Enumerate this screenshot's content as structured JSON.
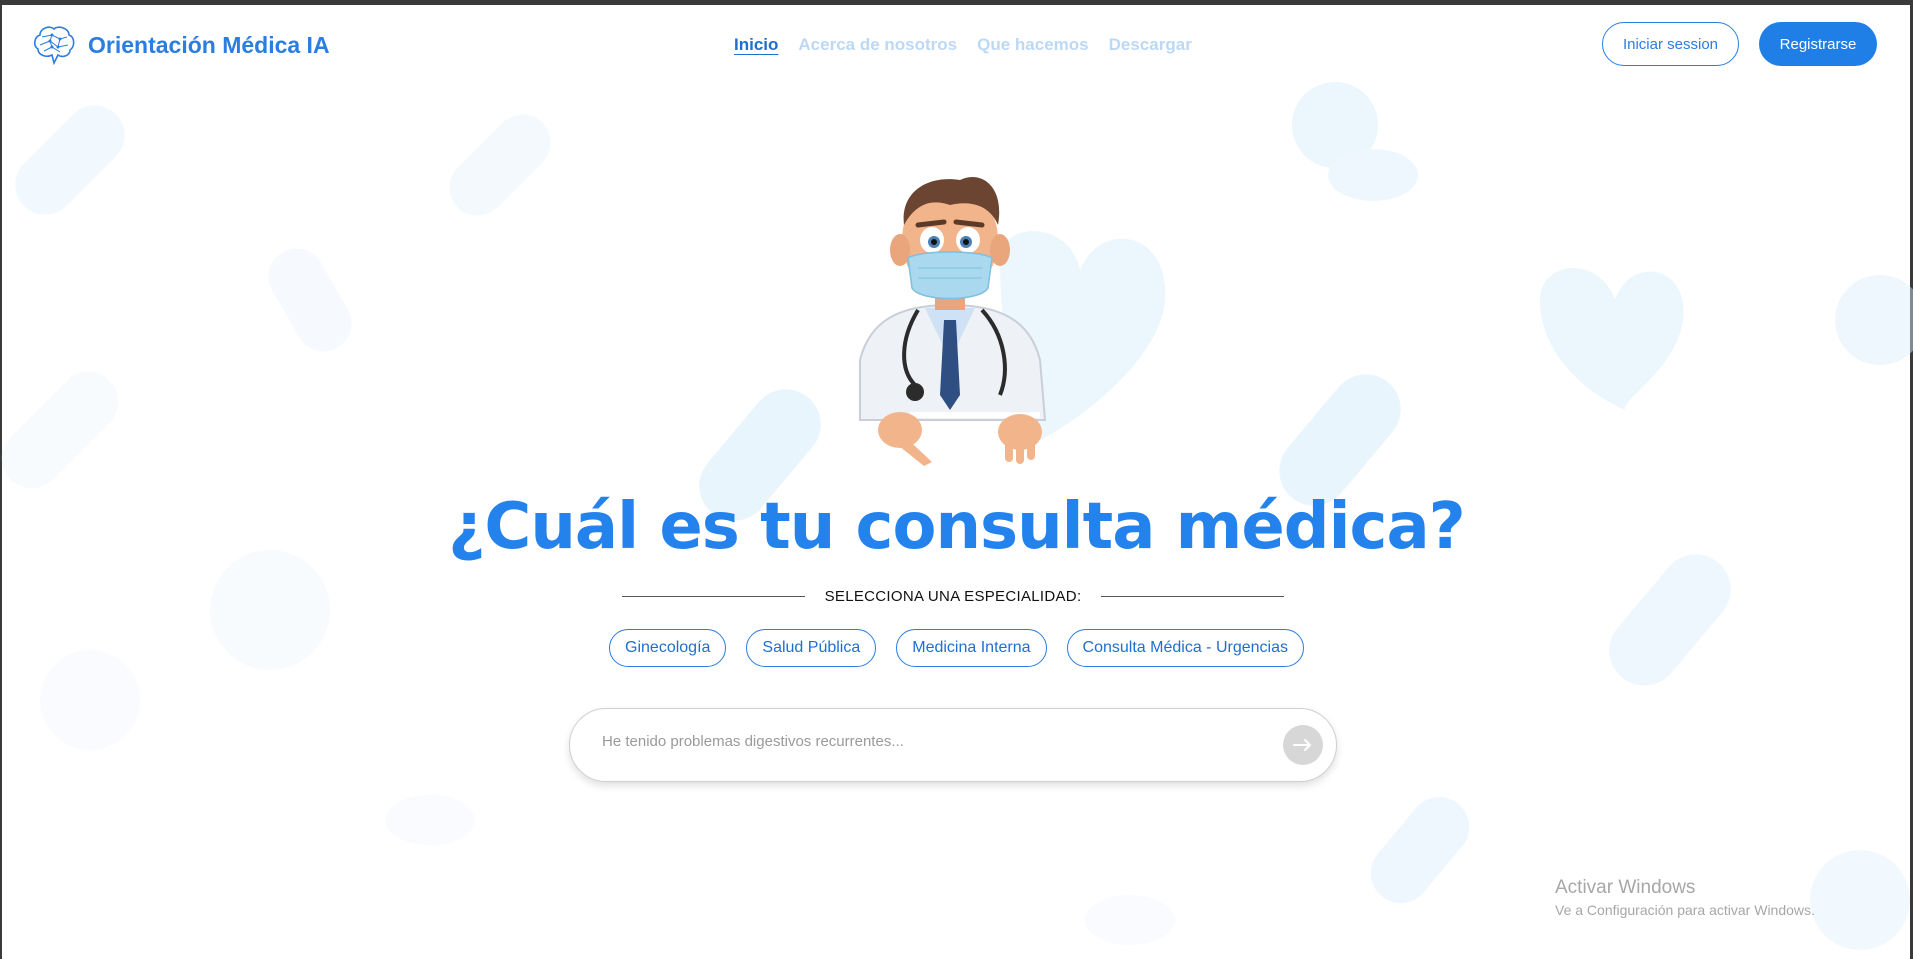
{
  "brand": {
    "title": "Orientación Médica IA",
    "icon": "brain-icon",
    "color": "#2a7de1"
  },
  "nav": {
    "items": [
      {
        "label": "Inicio",
        "active": true
      },
      {
        "label": "Acerca de nosotros",
        "active": false
      },
      {
        "label": "Que hacemos",
        "active": false
      },
      {
        "label": "Descargar",
        "active": false
      }
    ]
  },
  "auth": {
    "login_label": "Iniciar session",
    "register_label": "Registrarse"
  },
  "hero": {
    "illustration": "doctor-mascot",
    "headline": "¿Cuál es tu consulta médica?",
    "specialty_prompt": "SELECCIONA UNA ESPECIALIDAD:",
    "specialties": [
      "Ginecología",
      "Salud Pública",
      "Medicina Interna",
      "Consulta Médica - Urgencias"
    ]
  },
  "search": {
    "placeholder": "He tenido problemas digestivos recurrentes...",
    "value": "",
    "send_icon": "arrow-right-icon"
  },
  "watermark": {
    "title": "Activar Windows",
    "subtitle": "Ve a Configuración para activar Windows."
  },
  "colors": {
    "primary": "#1f7fe6",
    "headline": "#2482ec",
    "nav_inactive": "#bcd8f5"
  }
}
